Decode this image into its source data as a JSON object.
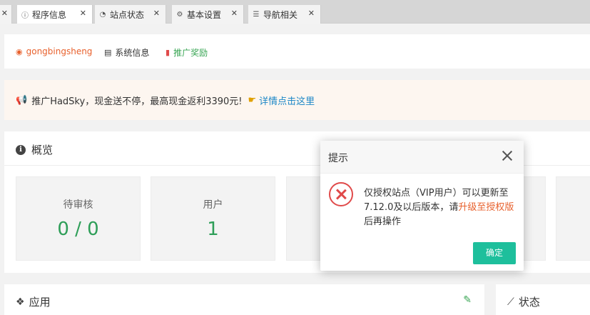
{
  "tabs": [
    {
      "label": "程序信息",
      "icon": "info-icon"
    },
    {
      "label": "站点状态",
      "icon": "dashboard-icon"
    },
    {
      "label": "基本设置",
      "icon": "gear-icon"
    },
    {
      "label": "导航相关",
      "icon": "list-icon"
    }
  ],
  "userbar": {
    "username": "gongbingsheng",
    "system_info": "系统信息",
    "promo_reward": "推广奖励"
  },
  "promo": {
    "text": "推广HadSky，现金送不停，最高现金返利3390元!",
    "link": "详情点击这里"
  },
  "overview": {
    "title": "概览",
    "stats": [
      {
        "label": "待审核",
        "value": "0 / 0"
      },
      {
        "label": "用户",
        "value": "1"
      }
    ]
  },
  "apps": {
    "title": "应用"
  },
  "status": {
    "title": "状态"
  },
  "dialog": {
    "title": "提示",
    "message_part1": "仅授权站点（VIP用户）可以更新至7.12.0及以后版本，请",
    "message_link": "升级至授权版",
    "message_part2": "后再操作",
    "ok_label": "确定"
  },
  "colors": {
    "accent": "#1ebf9c",
    "error": "#e04a4a",
    "highlight": "#e8612d",
    "stat_value": "#2e9e58",
    "link": "#1e88c7"
  }
}
